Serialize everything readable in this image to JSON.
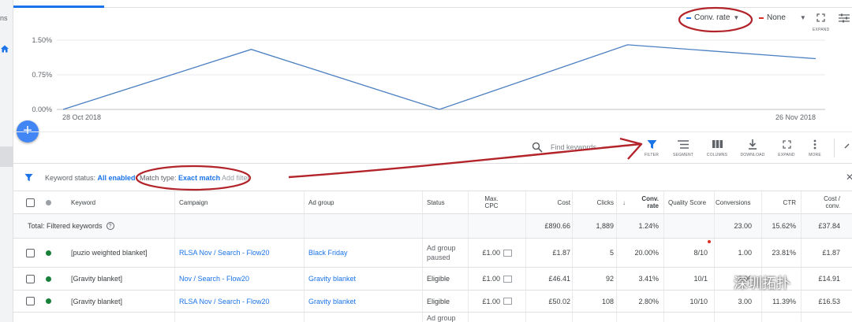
{
  "sidebar": {
    "cut_text": "ns"
  },
  "chart_controls": {
    "metric1": {
      "label": "Conv. rate",
      "color": "#1a73e8"
    },
    "metric2": {
      "label": "None",
      "color": "#d93025"
    },
    "expand_label": "EXPAND"
  },
  "chart_data": {
    "type": "line",
    "x_start_label": "28 Oct 2018",
    "x_end_label": "26 Nov 2018",
    "y_ticks": [
      "1.50%",
      "0.75%",
      "0.00%"
    ],
    "ylim": [
      0,
      1.5
    ],
    "series": [
      {
        "values": [
          0.0,
          1.3,
          0.0,
          1.4,
          1.1
        ],
        "color": "#4a7fc1"
      }
    ]
  },
  "toolbar": {
    "search_placeholder": "Find keywords",
    "buttons": [
      {
        "label": "FILTER"
      },
      {
        "label": "SEGMENT"
      },
      {
        "label": "COLUMNS"
      },
      {
        "label": "DOWNLOAD"
      },
      {
        "label": "EXPAND"
      },
      {
        "label": "MORE"
      }
    ]
  },
  "filters": {
    "chip1_label": "Keyword status:",
    "chip1_value": "All enabled",
    "chip2_label": "Match type:",
    "chip2_value": "Exact match",
    "add_filter": "Add filter"
  },
  "table": {
    "headers": {
      "keyword": "Keyword",
      "campaign": "Campaign",
      "ad_group": "Ad group",
      "status": "Status",
      "max_cpc_1": "Max.",
      "max_cpc_2": "CPC",
      "cost": "Cost",
      "clicks": "Clicks",
      "conv_rate_1": "Conv.",
      "conv_rate_2": "rate",
      "quality_score": "Quality Score",
      "conversions": "Conversions",
      "ctr": "CTR",
      "cost_conv_1": "Cost /",
      "cost_conv_2": "conv."
    },
    "total": {
      "label": "Total: Filtered keywords",
      "cost": "£890.66",
      "clicks": "1,889",
      "conv_rate": "1.24%",
      "conversions": "23.00",
      "ctr": "15.62%",
      "cost_conv": "£37.84"
    },
    "rows": [
      {
        "keyword": "[puzio weighted blanket]",
        "campaign": "RLSA Nov / Search - Flow20",
        "ad_group": "Black Friday",
        "status_1": "Ad group",
        "status_2": "paused",
        "max_cpc": "£1.00",
        "cost": "£1.87",
        "clicks": "5",
        "conv_rate": "20.00%",
        "quality_score": "8/10",
        "conversions": "1.00",
        "ctr": "23.81%",
        "cost_conv": "£1.87"
      },
      {
        "keyword": "[Gravity blanket]",
        "campaign": "Nov / Search - Flow20",
        "ad_group": "Gravity blanket",
        "status_1": "Eligible",
        "status_2": "",
        "max_cpc": "£1.00",
        "cost": "£46.41",
        "clicks": "92",
        "conv_rate": "3.41%",
        "quality_score": "10/1",
        "conversions": "3.00",
        "ctr": "",
        "cost_conv": "£14.91"
      },
      {
        "keyword": "[Gravity blanket]",
        "campaign": "RLSA Nov / Search - Flow20",
        "ad_group": "Gravity blanket",
        "status_1": "Eligible",
        "status_2": "",
        "max_cpc": "£1.00",
        "cost": "£50.02",
        "clicks": "108",
        "conv_rate": "2.80%",
        "quality_score": "10/10",
        "conversions": "3.00",
        "ctr": "11.39%",
        "cost_conv": "£16.53"
      }
    ],
    "partial_row_status": "Ad group"
  },
  "watermark": {
    "text": "深圳拓扑"
  }
}
